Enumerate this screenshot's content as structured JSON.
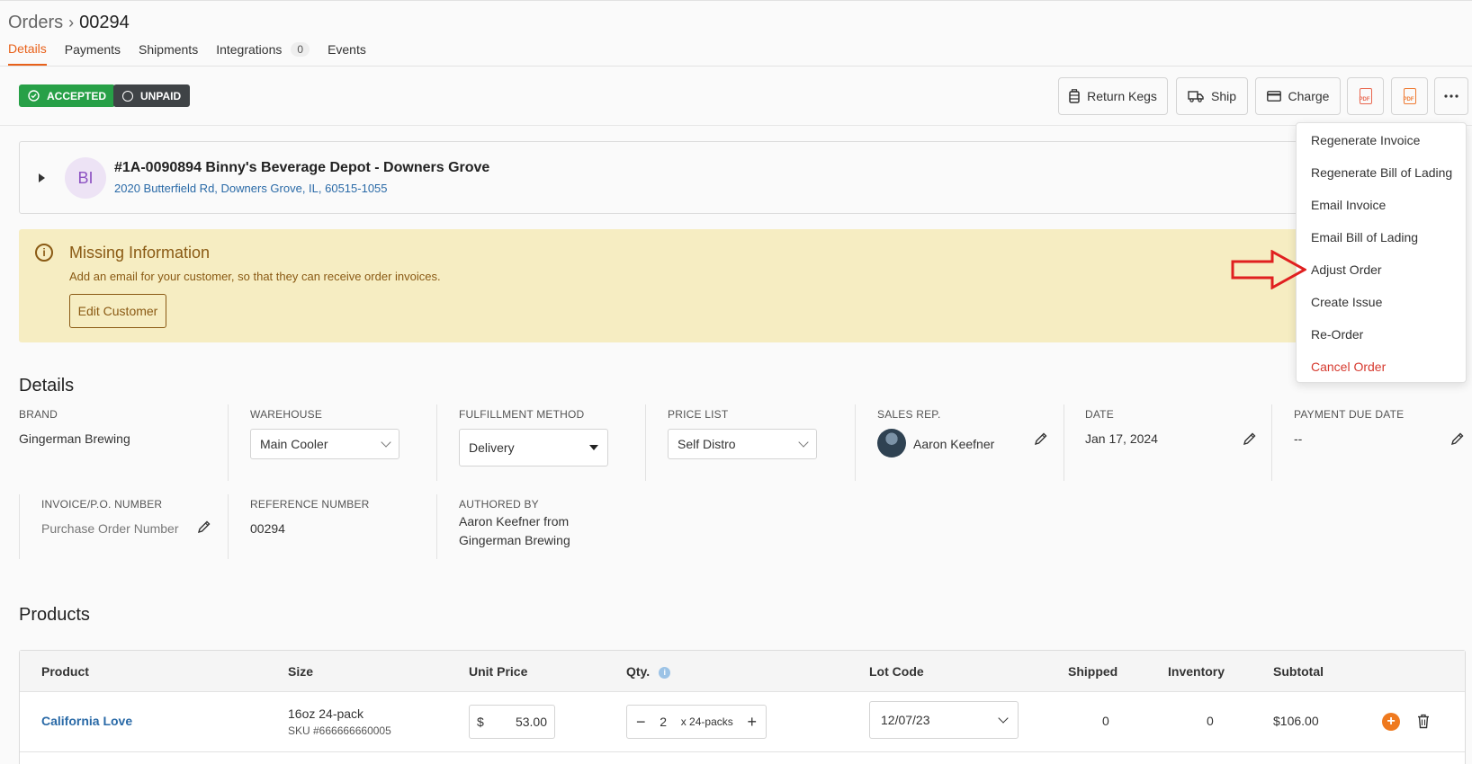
{
  "breadcrumb": {
    "parent": "Orders",
    "current": "00294"
  },
  "tabs": [
    {
      "label": "Details"
    },
    {
      "label": "Payments"
    },
    {
      "label": "Shipments"
    },
    {
      "label": "Integrations",
      "count": "0"
    },
    {
      "label": "Events"
    }
  ],
  "status": {
    "accepted": "ACCEPTED",
    "unpaid": "UNPAID"
  },
  "toolbar": {
    "return_kegs": "Return Kegs",
    "ship": "Ship",
    "charge": "Charge"
  },
  "customer": {
    "initials": "BI",
    "name": "#1A-0090894 Binny's Beverage Depot - Downers Grove",
    "address": "2020 Butterfield Rd, Downers Grove, IL, 60515-1055"
  },
  "alert": {
    "icon": "i",
    "title": "Missing Information",
    "message": "Add an email for your customer, so that they can receive order invoices.",
    "button": "Edit Customer"
  },
  "details": {
    "heading": "Details",
    "brand_label": "BRAND",
    "brand": "Gingerman Brewing",
    "warehouse_label": "WAREHOUSE",
    "warehouse": "Main Cooler",
    "fulfillment_label": "FULFILLMENT METHOD",
    "fulfillment": "Delivery",
    "price_list_label": "PRICE LIST",
    "price_list": "Self Distro",
    "sales_rep_label": "SALES REP.",
    "sales_rep": "Aaron Keefner",
    "date_label": "DATE",
    "date": "Jan 17, 2024",
    "due_label": "PAYMENT DUE DATE",
    "due": "--",
    "po_label": "INVOICE/P.O. NUMBER",
    "po_placeholder": "Purchase Order Number",
    "ref_label": "REFERENCE NUMBER",
    "ref": "00294",
    "authored_label": "AUTHORED BY",
    "authored_line1": "Aaron Keefner from",
    "authored_line2": "Gingerman Brewing"
  },
  "products": {
    "heading": "Products",
    "columns": [
      "Product",
      "Size",
      "Unit Price",
      "Qty.",
      "Lot Code",
      "Shipped",
      "Inventory",
      "Subtotal"
    ],
    "qty_info_icon": "i",
    "rows": [
      {
        "product": "California Love",
        "size": "16oz 24-pack",
        "sku": "SKU #666666660005",
        "currency": "$",
        "unit_price": "53.00",
        "qty": "2",
        "unit": "x 24-packs",
        "lot_code": "12/07/23",
        "shipped": "0",
        "inventory": "0",
        "subtotal": "$106.00"
      }
    ]
  },
  "menu": {
    "items": [
      "Regenerate Invoice",
      "Regenerate Bill of Lading",
      "Email Invoice",
      "Email Bill of Lading",
      "Adjust Order",
      "Create Issue",
      "Re-Order",
      "Cancel Order"
    ]
  },
  "colors": {
    "accent": "#e8611a",
    "success": "#27a047",
    "danger": "#d63a2f",
    "link": "#2a6aa7",
    "warning_bg": "#f6edc2",
    "annotation": "#e02020"
  }
}
